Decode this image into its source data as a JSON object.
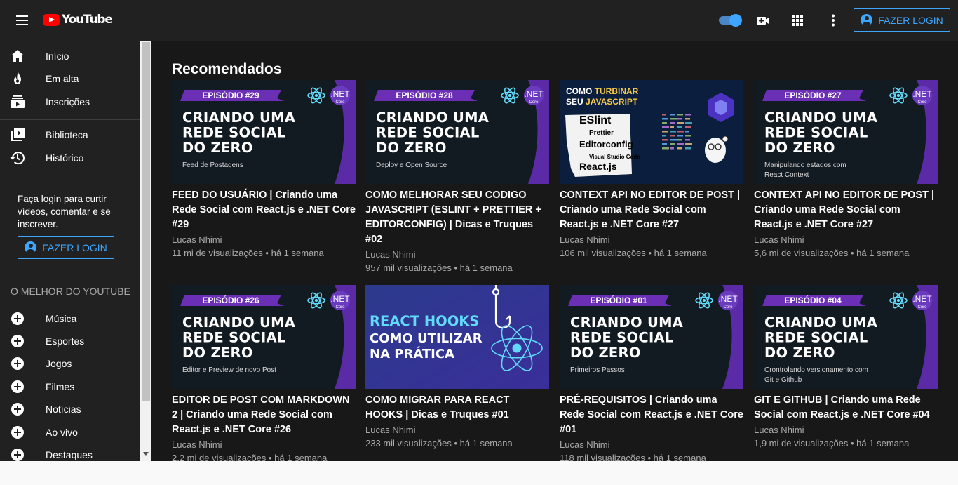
{
  "header": {
    "logo_text": "YouTube",
    "login_label": "FAZER LOGIN",
    "icons": [
      "menu-icon",
      "video-camera-add-icon",
      "apps-grid-icon",
      "more-vert-icon",
      "account-circle-icon"
    ],
    "accent_color": "#3ea6ff",
    "brand_color": "#ff0000"
  },
  "sidebar": {
    "main_items": [
      {
        "label": "Início",
        "icon": "home-icon"
      },
      {
        "label": "Em alta",
        "icon": "trending-fire-icon"
      },
      {
        "label": "Inscrições",
        "icon": "subscriptions-icon"
      }
    ],
    "library_items": [
      {
        "label": "Biblioteca",
        "icon": "library-icon"
      },
      {
        "label": "Histórico",
        "icon": "history-icon"
      }
    ],
    "login_prompt": "Faça login para curtir vídeos, comentar e se inscrever.",
    "login_label": "FAZER LOGIN",
    "best_of_title": "O MELHOR DO YOUTUBE",
    "best_of_items": [
      {
        "label": "Música",
        "icon": "add-circle-icon"
      },
      {
        "label": "Esportes",
        "icon": "add-circle-icon"
      },
      {
        "label": "Jogos",
        "icon": "add-circle-icon"
      },
      {
        "label": "Filmes",
        "icon": "add-circle-icon"
      },
      {
        "label": "Notícias",
        "icon": "add-circle-icon"
      },
      {
        "label": "Ao vivo",
        "icon": "add-circle-icon"
      },
      {
        "label": "Destaques",
        "icon": "add-circle-icon"
      }
    ]
  },
  "main": {
    "section_title": "Recomendados",
    "videos": [
      {
        "title": "FEED DO USUÁRIO | Criando uma Rede Social com React.js e .NET Core #29",
        "channel": "Lucas Nhimi",
        "stats": "11 mi de visualizações • há 1 semana",
        "thumb": {
          "kind": "episode",
          "badge": "EPISÓDIO #29",
          "lines": [
            "CRIANDO UMA",
            "REDE SOCIAL",
            "DO ZERO"
          ],
          "subtitle": [
            "Feed de Postagens"
          ],
          "net": ".NET",
          "core": "Core"
        }
      },
      {
        "title": "COMO MELHORAR SEU CODIGO JAVASCRIPT (ESLINT + PRETTIER + EDITORCONFIG) | Dicas e Truques #02",
        "channel": "Lucas Nhimi",
        "stats": "957 mil visualizações • há 1 semana",
        "thumb": {
          "kind": "episode",
          "badge": "EPISÓDIO #28",
          "lines": [
            "CRIANDO UMA",
            "REDE SOCIAL",
            "DO ZERO"
          ],
          "subtitle": [
            "Deploy e Open Source"
          ],
          "net": ".NET",
          "core": "Core"
        }
      },
      {
        "title": "CONTEXT API NO EDITOR DE POST | Criando uma Rede Social com React.js e .NET Core #27",
        "channel": "Lucas Nhimi",
        "stats": "106 mil visualizações • há 1 semana",
        "thumb": {
          "kind": "eslint",
          "header_a": "COMO ",
          "header_b": "TURBINAR",
          "header_c": "SEU ",
          "header_d": "JAVASCRIPT",
          "tags": [
            "ESlint",
            "Prettier",
            "Editorconfig",
            "Visual Studio Code",
            "React.js"
          ]
        }
      },
      {
        "title": "CONTEXT API NO EDITOR DE POST | Criando uma Rede Social com React.js e .NET Core #27",
        "channel": "Lucas Nhimi",
        "stats": "5,6 mi de visualizações • há 1 semana",
        "thumb": {
          "kind": "episode",
          "badge": "EPISÓDIO #27",
          "lines": [
            "CRIANDO UMA",
            "REDE SOCIAL",
            "DO ZERO"
          ],
          "subtitle": [
            "Manipulando estados com",
            "React Context"
          ],
          "net": ".NET",
          "core": "Core"
        }
      },
      {
        "title": "EDITOR DE POST COM MARKDOWN 2 | Criando uma Rede Social com React.js e .NET Core #26",
        "channel": "Lucas Nhimi",
        "stats": "2,2 mi de visualizações • há 1 semana",
        "thumb": {
          "kind": "episode",
          "badge": "EPISÓDIO #26",
          "lines": [
            "CRIANDO UMA",
            "REDE SOCIAL",
            "DO ZERO"
          ],
          "subtitle": [
            "Editor e Preview de novo Post"
          ],
          "net": ".NET",
          "core": "Core"
        }
      },
      {
        "title": "COMO MIGRAR PARA REACT HOOKS | Dicas e Truques #01",
        "channel": "Lucas Nhimi",
        "stats": "233 mil visualizações • há 1 semana",
        "thumb": {
          "kind": "hooks",
          "line1": "REACT HOOKS",
          "line2": "COMO UTILIZAR",
          "line3": "NA PRÁTICA"
        }
      },
      {
        "title": "PRÉ-REQUISITOS | Criando uma Rede Social com React.js e .NET Core #01",
        "channel": "Lucas Nhimi",
        "stats": "118 mil visualizações • há 1 semana",
        "thumb": {
          "kind": "episode",
          "badge": "EPISÓDIO #01",
          "lines": [
            "CRIANDO UMA",
            "REDE SOCIAL",
            "DO ZERO"
          ],
          "subtitle": [
            "Primeiros Passos"
          ],
          "net": ".NET",
          "core": "Core"
        }
      },
      {
        "title": "GIT E GITHUB | Criando uma Rede Social com React.js e .NET Core #04",
        "channel": "Lucas Nhimi",
        "stats": "1,9 mi de visualizações • há 1 semana",
        "thumb": {
          "kind": "episode",
          "badge": "EPISÓDIO #04",
          "lines": [
            "CRIANDO UMA",
            "REDE SOCIAL",
            "DO ZERO"
          ],
          "subtitle": [
            "Crontrolando versionamento com",
            "Git e Github"
          ],
          "net": ".NET",
          "core": "Core"
        }
      }
    ]
  }
}
